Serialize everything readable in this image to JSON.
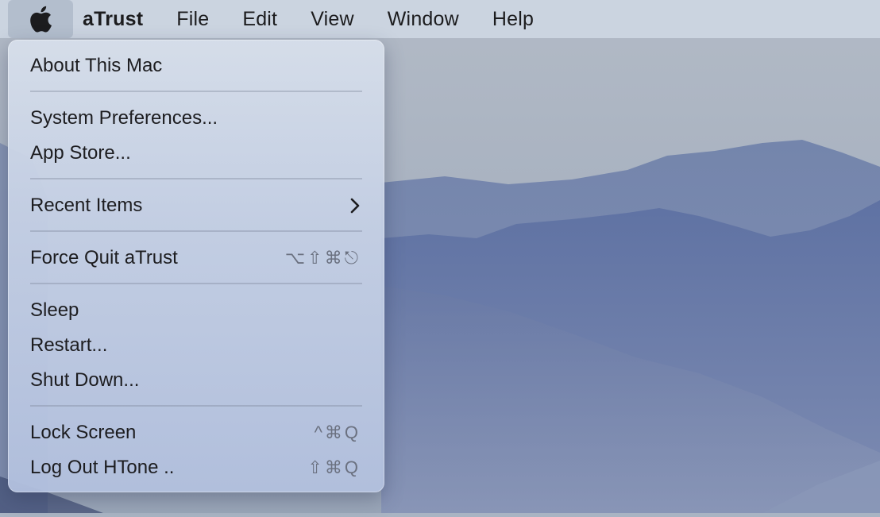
{
  "menubar": {
    "apple_icon": "apple-logo-icon",
    "items": [
      "aTrust",
      "File",
      "Edit",
      "View",
      "Window",
      "Help"
    ]
  },
  "apple_menu": {
    "about": "About This Mac",
    "system_prefs": "System Preferences...",
    "app_store": "App Store...",
    "recent_items": "Recent Items",
    "force_quit": "Force Quit aTrust",
    "force_quit_shortcut": "⌥⇧⌘⎋",
    "sleep": "Sleep",
    "restart": "Restart...",
    "shut_down": "Shut Down...",
    "lock_screen": "Lock Screen",
    "lock_screen_shortcut": "^⌘Q",
    "log_out": "Log Out  HTone ..",
    "log_out_shortcut": "⇧⌘Q"
  },
  "colors": {
    "menu_bg": "#c6d0e2",
    "text": "#1d1d20",
    "shortcut": "#6b7180"
  }
}
